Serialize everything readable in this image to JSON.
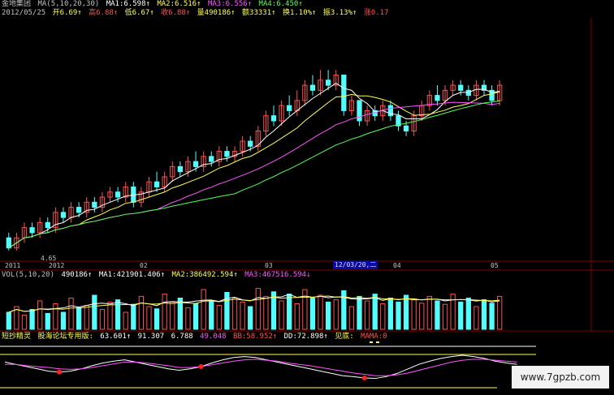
{
  "header": {
    "stock": "金地集团",
    "ma_label": "MA(5,10,20,30)",
    "ma1": "MA1:6.598↑",
    "ma2": "MA2:6.516↑",
    "ma3": "MA3:6.556↑",
    "ma4": "MA4:6.450↑",
    "date": "2012/05/25",
    "open": "开6.69↑",
    "high": "高6.88↑",
    "low": "低6.67↑",
    "close": "收6.88↑",
    "volume": "量490186↑",
    "amount": "额33331↑",
    "turnover": "换1.10%↑",
    "amplitude": "振3.13%↑",
    "change": "涨0.17"
  },
  "price_low_label": "4.65",
  "xaxis": {
    "t2011": "2011",
    "t2012": "2012",
    "t02": "02",
    "t03": "03",
    "sel": "12/03/20,二",
    "t04": "04",
    "t05": "05"
  },
  "vol": {
    "label": "VOL(5,10,20)",
    "v": "490186↑",
    "ma1": "MA1:421901.406↑",
    "ma2": "MA2:386492.594↑",
    "ma3": "MA3:467516.594↓"
  },
  "ind": {
    "name": "短抄精灵",
    "sub": "股海论坛专用版:",
    "v1": "63.601↑",
    "v2": "91.307",
    "v3": "6.788",
    "v4": "49.048",
    "v5": "BB:58.952↑",
    "v6": "DD:72.898↑",
    "v7": "见底:",
    "v8": "MAMA:0"
  },
  "watermark": "www.7gpzb.com",
  "colors": {
    "up": "#ff5050",
    "down": "#54fcfc",
    "ma1": "#ffffff",
    "ma2": "#ffff54",
    "ma3": "#ff54ff",
    "ma4": "#54ff54",
    "grid": "#800000"
  },
  "chart_data": {
    "type": "candlestick",
    "candles": [
      [
        4.9,
        4.7,
        5.0,
        4.65
      ],
      [
        4.7,
        4.9,
        5.0,
        4.65
      ],
      [
        4.9,
        5.1,
        5.2,
        4.8
      ],
      [
        5.1,
        5.0,
        5.2,
        4.9
      ],
      [
        5.0,
        5.2,
        5.3,
        4.9
      ],
      [
        5.2,
        5.1,
        5.3,
        5.0
      ],
      [
        5.1,
        5.4,
        5.5,
        5.0
      ],
      [
        5.4,
        5.3,
        5.5,
        5.2
      ],
      [
        5.3,
        5.5,
        5.6,
        5.2
      ],
      [
        5.5,
        5.4,
        5.6,
        5.3
      ],
      [
        5.4,
        5.6,
        5.7,
        5.3
      ],
      [
        5.6,
        5.5,
        5.7,
        5.4
      ],
      [
        5.5,
        5.7,
        5.8,
        5.4
      ],
      [
        5.7,
        5.8,
        5.9,
        5.6
      ],
      [
        5.8,
        5.7,
        5.9,
        5.6
      ],
      [
        5.7,
        5.9,
        6.0,
        5.6
      ],
      [
        5.9,
        5.6,
        6.0,
        5.5
      ],
      [
        5.6,
        5.8,
        5.9,
        5.5
      ],
      [
        5.8,
        6.0,
        6.1,
        5.7
      ],
      [
        6.0,
        5.9,
        6.2,
        5.8
      ],
      [
        5.9,
        6.1,
        6.2,
        5.8
      ],
      [
        6.1,
        6.3,
        6.4,
        6.0
      ],
      [
        6.3,
        6.2,
        6.4,
        6.1
      ],
      [
        6.2,
        6.4,
        6.5,
        6.1
      ],
      [
        6.4,
        6.3,
        6.6,
        6.2
      ],
      [
        6.3,
        6.5,
        6.6,
        6.2
      ],
      [
        6.5,
        6.4,
        6.6,
        6.3
      ],
      [
        6.4,
        6.6,
        6.7,
        6.3
      ],
      [
        6.6,
        6.5,
        6.7,
        6.4
      ],
      [
        6.5,
        6.6,
        6.7,
        6.4
      ],
      [
        6.6,
        6.8,
        6.9,
        6.5
      ],
      [
        6.8,
        6.7,
        6.9,
        6.6
      ],
      [
        6.7,
        7.0,
        7.1,
        6.6
      ],
      [
        7.0,
        7.3,
        7.4,
        6.9
      ],
      [
        7.3,
        7.2,
        7.5,
        7.1
      ],
      [
        7.2,
        7.5,
        7.6,
        7.1
      ],
      [
        7.5,
        7.4,
        7.7,
        7.3
      ],
      [
        7.4,
        7.6,
        7.8,
        7.3
      ],
      [
        7.6,
        7.9,
        8.0,
        7.5
      ],
      [
        7.9,
        7.8,
        8.1,
        7.7
      ],
      [
        7.8,
        8.0,
        8.2,
        7.7
      ],
      [
        8.0,
        7.9,
        8.2,
        7.8
      ],
      [
        7.9,
        8.1,
        8.2,
        7.8
      ],
      [
        8.1,
        7.4,
        8.1,
        7.3
      ],
      [
        7.4,
        7.6,
        7.7,
        7.3
      ],
      [
        7.6,
        7.2,
        7.6,
        7.1
      ],
      [
        7.2,
        7.4,
        7.5,
        7.1
      ],
      [
        7.4,
        7.3,
        7.5,
        7.2
      ],
      [
        7.3,
        7.5,
        7.6,
        7.2
      ],
      [
        7.5,
        7.3,
        7.6,
        7.2
      ],
      [
        7.3,
        7.1,
        7.4,
        7.0
      ],
      [
        7.1,
        7.0,
        7.2,
        6.9
      ],
      [
        7.0,
        7.3,
        7.4,
        6.9
      ],
      [
        7.3,
        7.5,
        7.6,
        7.2
      ],
      [
        7.5,
        7.7,
        7.8,
        7.4
      ],
      [
        7.7,
        7.6,
        7.9,
        7.5
      ],
      [
        7.6,
        7.8,
        7.9,
        7.5
      ],
      [
        7.8,
        7.9,
        8.0,
        7.7
      ],
      [
        7.9,
        7.8,
        8.0,
        7.7
      ],
      [
        7.8,
        7.7,
        7.9,
        7.6
      ],
      [
        7.7,
        7.9,
        8.0,
        7.6
      ],
      [
        7.9,
        7.8,
        8.0,
        7.7
      ],
      [
        7.8,
        7.6,
        7.9,
        7.5
      ],
      [
        7.6,
        7.9,
        8.0,
        7.5
      ]
    ],
    "ma_series": [
      "MA1",
      "MA2",
      "MA3",
      "MA4"
    ],
    "volumes": [
      30,
      40,
      25,
      35,
      50,
      28,
      45,
      30,
      55,
      38,
      42,
      60,
      35,
      48,
      52,
      30,
      44,
      58,
      40,
      36,
      62,
      48,
      55,
      38,
      45,
      70,
      50,
      42,
      65,
      55,
      48,
      40,
      72,
      58,
      66,
      50,
      62,
      45,
      70,
      55,
      60,
      48,
      52,
      68,
      40,
      58,
      50,
      62,
      45,
      55,
      48,
      60,
      52,
      46,
      58,
      50,
      44,
      62,
      48,
      55,
      40,
      52,
      46,
      58
    ],
    "indicator": {
      "white": [
        60,
        55,
        50,
        45,
        40,
        38,
        40,
        45,
        52,
        58,
        62,
        65,
        60,
        55,
        50,
        45,
        42,
        45,
        50,
        58,
        65,
        70,
        72,
        70,
        65,
        60,
        55,
        50,
        45,
        40,
        35,
        30,
        28,
        25,
        24,
        28,
        35,
        45,
        55,
        62,
        68,
        72,
        75,
        72,
        68,
        62,
        58,
        55
      ],
      "magenta": [
        55,
        55,
        52,
        50,
        48,
        45,
        44,
        45,
        48,
        52,
        56,
        60,
        60,
        58,
        55,
        52,
        48,
        48,
        50,
        54,
        58,
        62,
        65,
        66,
        64,
        62,
        58,
        55,
        52,
        48,
        44,
        40,
        36,
        33,
        30,
        30,
        32,
        36,
        42,
        48,
        54,
        60,
        64,
        66,
        66,
        64,
        62,
        60
      ],
      "low_marks": [
        5,
        18,
        33
      ]
    }
  }
}
